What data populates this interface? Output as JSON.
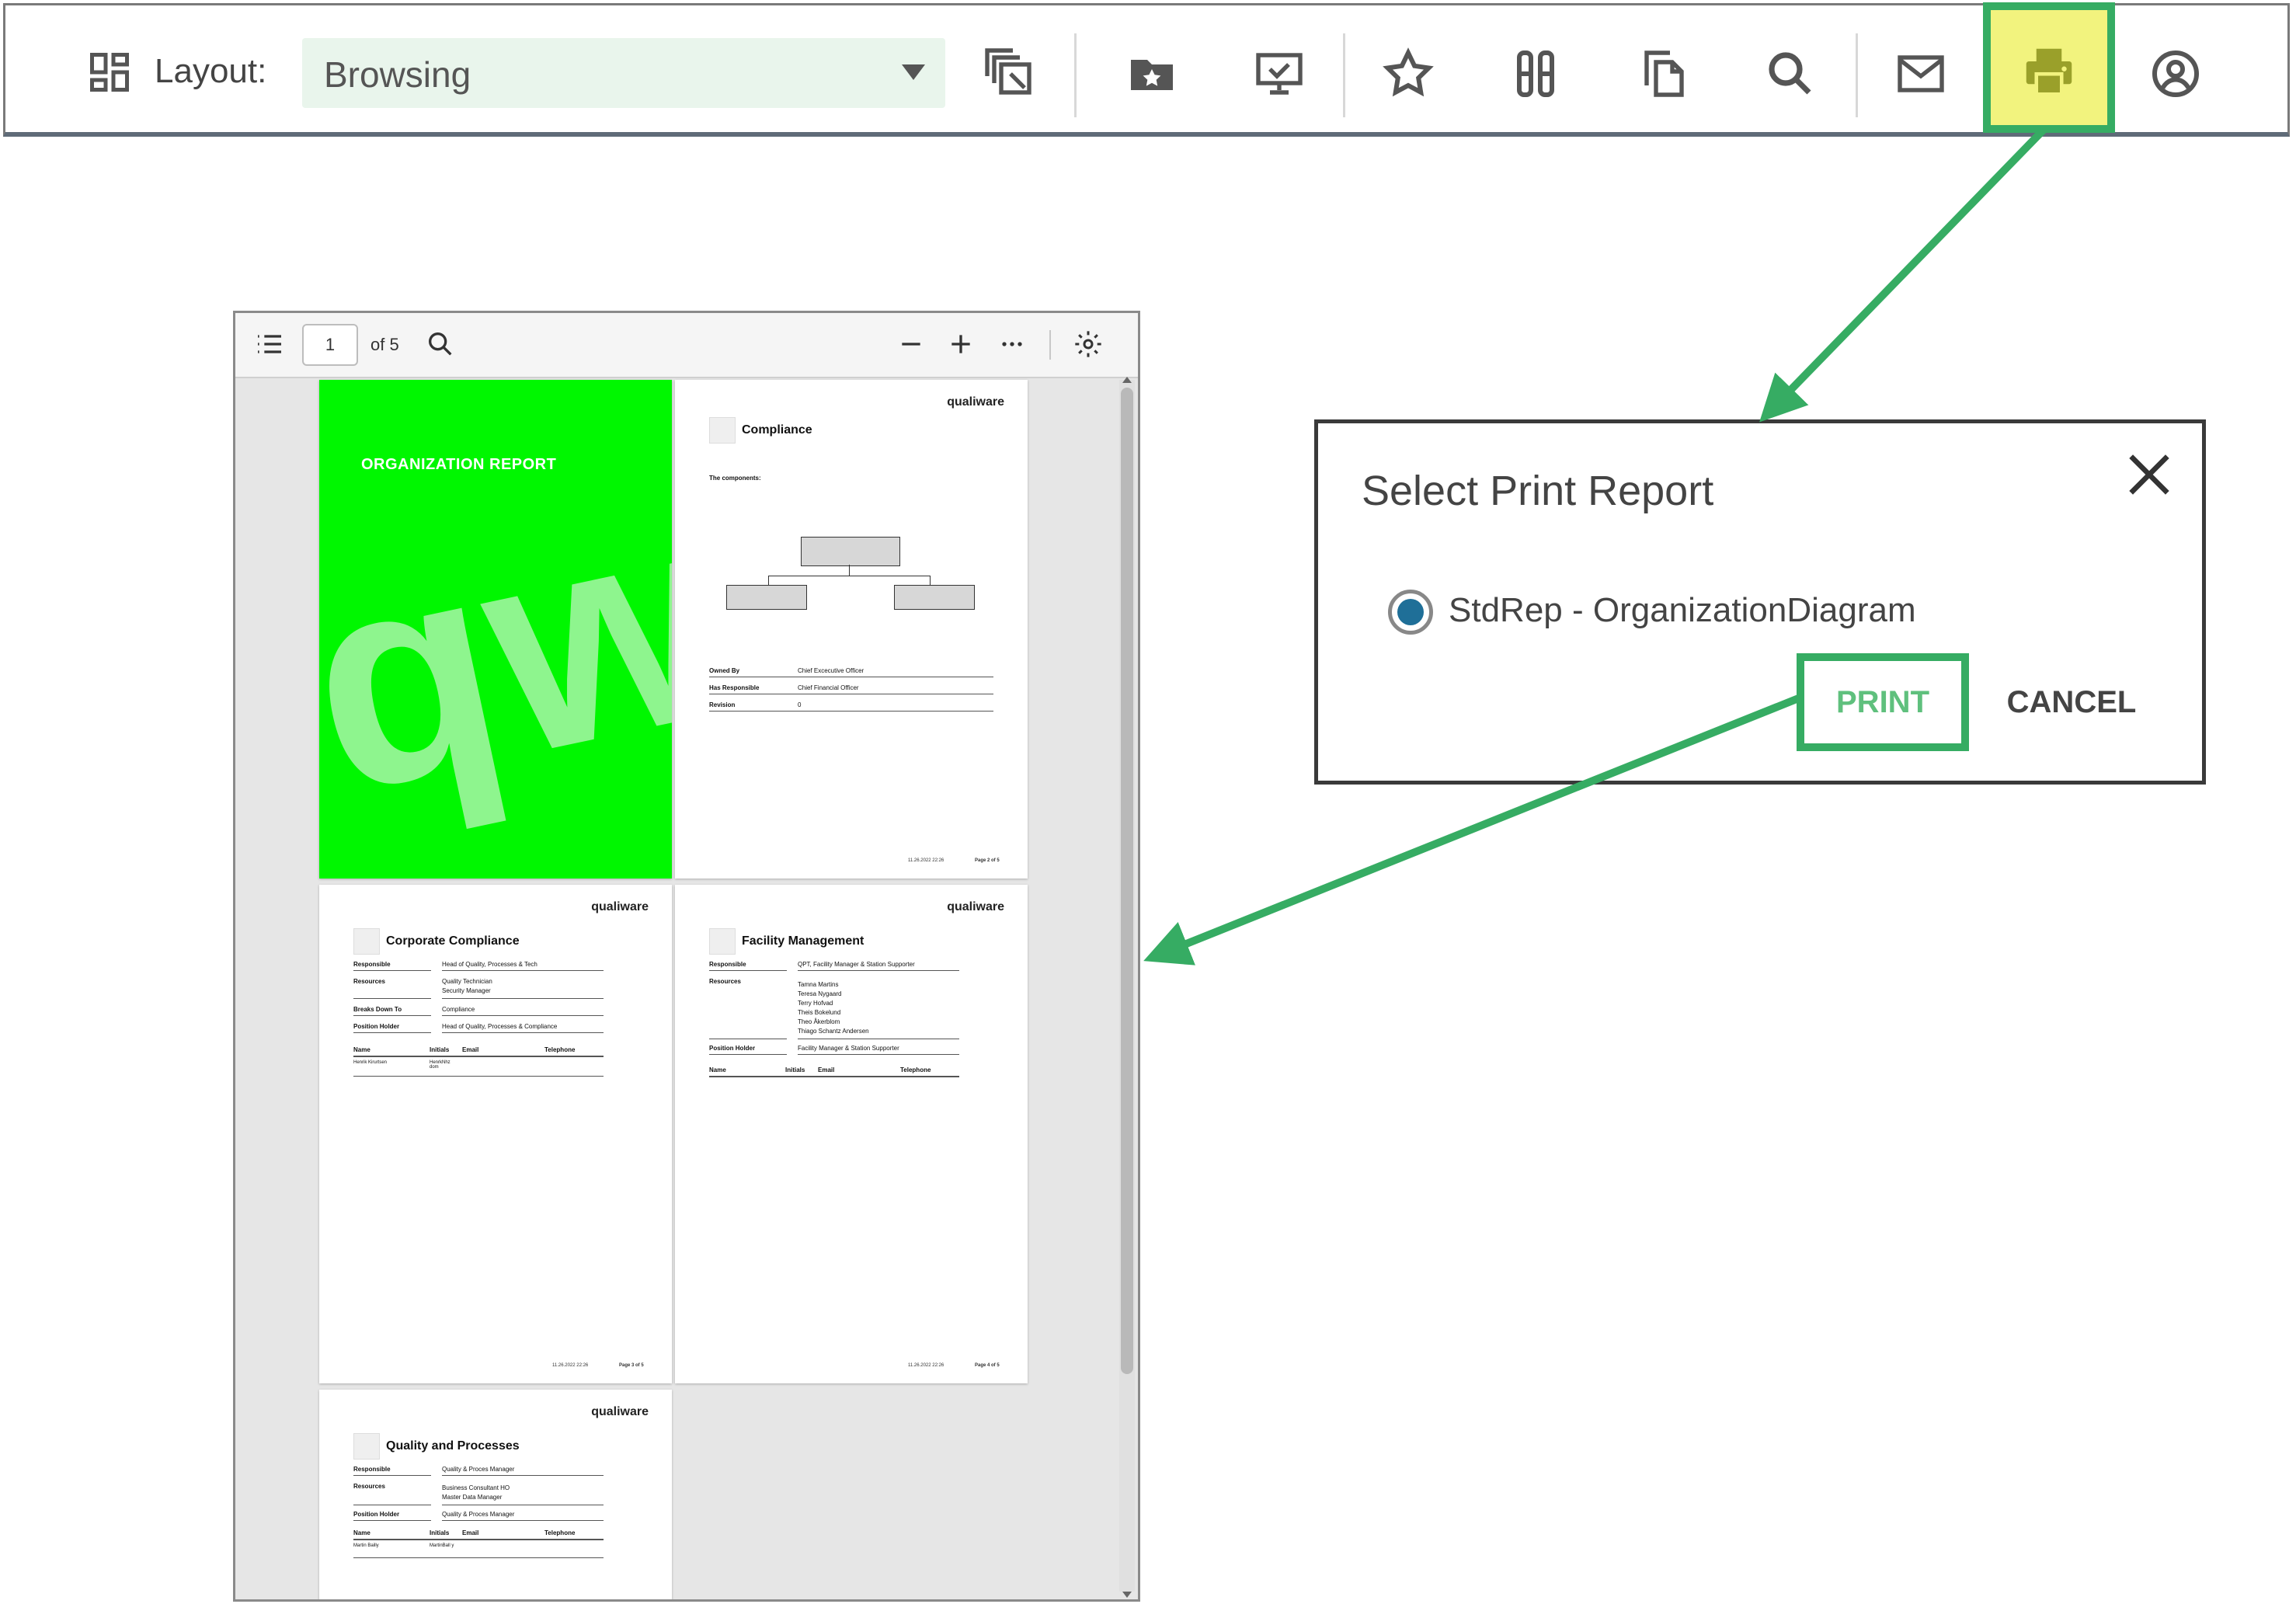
{
  "toolbar": {
    "layout_label": "Layout:",
    "layout_value": "Browsing",
    "icons": [
      "layers-icon",
      "folder-icon",
      "presentation-icon",
      "star-icon",
      "columns-icon",
      "copy-icon",
      "search-icon",
      "mail-icon",
      "print-icon",
      "account-icon"
    ],
    "highlight_color": "#36ac63",
    "print_bg": "#f2f37e"
  },
  "viewer": {
    "page_current": "1",
    "page_total": "of 5",
    "cover": {
      "title": "ORGANIZATION REPORT",
      "watermark": "qw",
      "color": "#00f700"
    },
    "pages": [
      {
        "logo": "qualiware",
        "heading": "Compliance",
        "subheading": "The components:",
        "fields": [
          {
            "label": "Owned By",
            "value": "Chief Excecutive Officer"
          },
          {
            "label": "Has Responsible",
            "value": "Chief Financial Officer"
          },
          {
            "label": "Revision",
            "value": "0"
          }
        ],
        "footer_page": "Page 2 of 5"
      },
      {
        "logo": "qualiware",
        "heading": "Corporate Compliance",
        "fields": [
          {
            "label": "Responsible",
            "value": "Head of Quality, Processes & Tech"
          },
          {
            "label": "Resources",
            "value": "Quality Technician"
          },
          {
            "label": "",
            "value": "Security Manager"
          },
          {
            "label": "Breaks Down To",
            "value": "Compliance"
          },
          {
            "label": "Position Holder",
            "value": "Head of Quality, Processes & Compliance"
          }
        ],
        "table_headers": [
          "Name",
          "Initials",
          "Email",
          "Telephone"
        ],
        "table_row": [
          "Henrik Kirurtsen",
          "HenrkNhz dom"
        ],
        "footer_page": "Page 3 of 5"
      },
      {
        "logo": "qualiware",
        "heading": "Facility Management",
        "fields": [
          {
            "label": "Responsible",
            "value": "QPT, Facility Manager & Station Supporter"
          },
          {
            "label": "Resources",
            "value": "Tamna Martins"
          },
          {
            "label": "",
            "value": "Teresa Nygaard"
          },
          {
            "label": "",
            "value": "Terry Hofvad"
          },
          {
            "label": "",
            "value": "Theis Bokelund"
          },
          {
            "label": "",
            "value": "Theo Åkerblom"
          },
          {
            "label": "",
            "value": "Thiago Schantz Andersen"
          },
          {
            "label": "Position Holder",
            "value": "Facility Manager & Station Supporter"
          }
        ],
        "table_headers": [
          "Name",
          "Initials",
          "Email",
          "Telephone"
        ],
        "footer_page": "Page 4 of 5"
      },
      {
        "logo": "qualiware",
        "heading": "Quality and Processes",
        "fields": [
          {
            "label": "Responsible",
            "value": "Quality & Proces Manager"
          },
          {
            "label": "Resources",
            "value": "Business Consultant HO"
          },
          {
            "label": "",
            "value": "Master Data Manager"
          },
          {
            "label": "Position Holder",
            "value": "Quality & Proces Manager"
          }
        ],
        "table_headers": [
          "Name",
          "Initials",
          "Email",
          "Telephone"
        ],
        "table_row": [
          "Martin Bailly",
          "MartinBall y"
        ]
      }
    ],
    "footer_date": "11.26.2022 22:26"
  },
  "dialog": {
    "title": "Select Print Report",
    "option_label": "StdRep - OrganizationDiagram",
    "print_label": "PRINT",
    "cancel_label": "CANCEL",
    "radio_color": "#1f6f98"
  }
}
